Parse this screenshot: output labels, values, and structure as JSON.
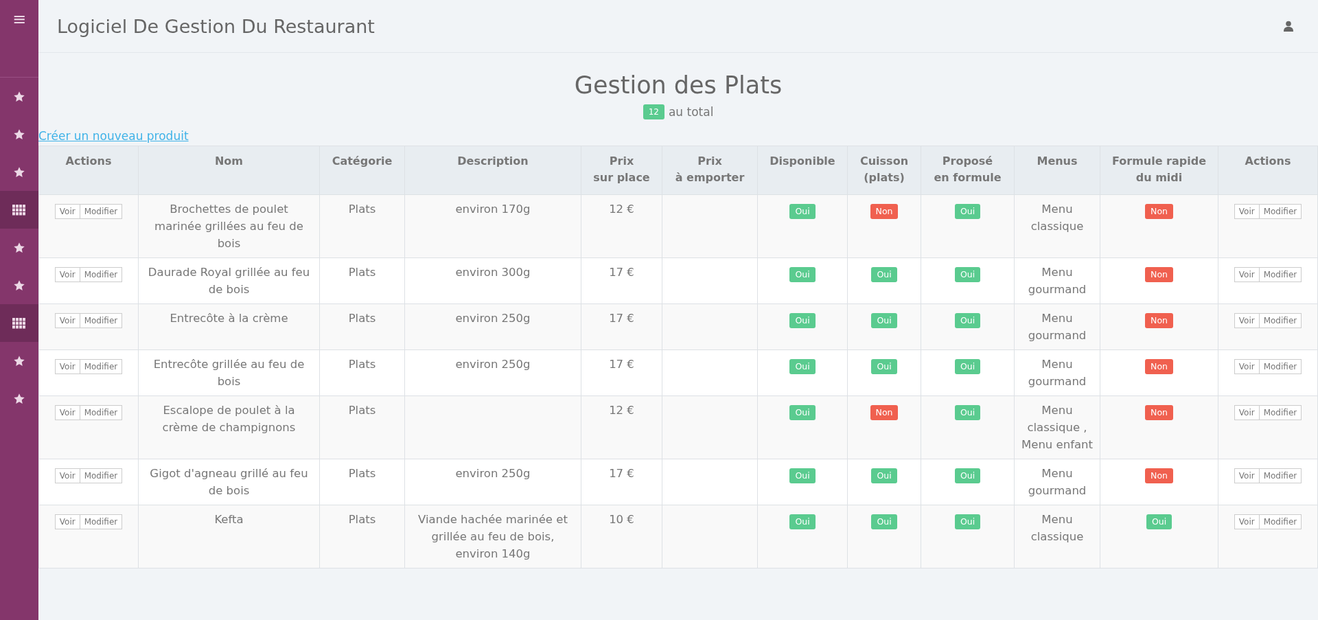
{
  "sidebar": {
    "menu_icon": "≡",
    "items": [
      {
        "kind": "star"
      },
      {
        "kind": "star"
      },
      {
        "kind": "star"
      },
      {
        "kind": "grid"
      },
      {
        "kind": "star"
      },
      {
        "kind": "star"
      },
      {
        "kind": "grid"
      },
      {
        "kind": "star"
      },
      {
        "kind": "star"
      }
    ]
  },
  "header": {
    "title": "Logiciel De Gestion Du Restaurant"
  },
  "page": {
    "title": "Gestion des Plats",
    "count": "12",
    "count_label": "au total",
    "create_link": "Créer un nouveau produit"
  },
  "table": {
    "columns": [
      "Actions",
      "Nom",
      "Catégorie",
      "Description",
      "Prix\nsur place",
      "Prix\nà emporter",
      "Disponible",
      "Cuisson\n(plats)",
      "Proposé\nen formule",
      "Menus",
      "Formule rapide\ndu midi",
      "Actions"
    ],
    "rows": [
      {
        "actions_left": [
          "Voir",
          "Modifier"
        ],
        "name": "Brochettes de poulet marinée grillées au feu de bois",
        "category": "Plats",
        "description": "environ 170g",
        "price_on_site": "12 €",
        "available": {
          "text": "Oui",
          "on": true
        },
        "cooking": {
          "text": "Non",
          "on": false
        },
        "in_formula": {
          "text": "Oui",
          "on": true
        },
        "menus": "Menu classique",
        "lunch_formula": {
          "text": "Non",
          "on": false
        },
        "actions_right": [
          "Voir",
          "Modifier"
        ]
      },
      {
        "actions_left": [
          "Voir",
          "Modifier"
        ],
        "name": "Daurade Royal grillée au feu de bois",
        "category": "Plats",
        "description": "environ 300g",
        "price_on_site": "17 €",
        "available": {
          "text": "Oui",
          "on": true
        },
        "cooking": {
          "text": "Oui",
          "on": true
        },
        "in_formula": {
          "text": "Oui",
          "on": true
        },
        "menus": "Menu gourmand",
        "lunch_formula": {
          "text": "Non",
          "on": false
        },
        "actions_right": [
          "Voir",
          "Modifier"
        ]
      },
      {
        "actions_left": [
          "Voir",
          "Modifier"
        ],
        "name": "Entrecôte à la crème",
        "category": "Plats",
        "description": "environ 250g",
        "price_on_site": "17 €",
        "available": {
          "text": "Oui",
          "on": true
        },
        "cooking": {
          "text": "Oui",
          "on": true
        },
        "in_formula": {
          "text": "Oui",
          "on": true
        },
        "menus": "Menu gourmand",
        "lunch_formula": {
          "text": "Non",
          "on": false
        },
        "actions_right": [
          "Voir",
          "Modifier"
        ]
      },
      {
        "actions_left": [
          "Voir",
          "Modifier"
        ],
        "name": "Entrecôte grillée au feu de bois",
        "category": "Plats",
        "description": "environ 250g",
        "price_on_site": "17 €",
        "available": {
          "text": "Oui",
          "on": true
        },
        "cooking": {
          "text": "Oui",
          "on": true
        },
        "in_formula": {
          "text": "Oui",
          "on": true
        },
        "menus": "Menu gourmand",
        "lunch_formula": {
          "text": "Non",
          "on": false
        },
        "actions_right": [
          "Voir",
          "Modifier"
        ]
      },
      {
        "actions_left": [
          "Voir",
          "Modifier"
        ],
        "name": "Escalope de poulet à la crème de champignons",
        "category": "Plats",
        "price_on_site": "12 €",
        "available": {
          "text": "Oui",
          "on": true
        },
        "cooking": {
          "text": "Non",
          "on": false
        },
        "in_formula": {
          "text": "Oui",
          "on": true
        },
        "menus": "Menu classique , Menu enfant",
        "lunch_formula": {
          "text": "Non",
          "on": false
        },
        "actions_right": [
          "Voir",
          "Modifier"
        ]
      },
      {
        "actions_left": [
          "Voir",
          "Modifier"
        ],
        "name": "Gigot d'agneau grillé au feu de bois",
        "category": "Plats",
        "description": "environ 250g",
        "price_on_site": "17 €",
        "available": {
          "text": "Oui",
          "on": true
        },
        "cooking": {
          "text": "Oui",
          "on": true
        },
        "in_formula": {
          "text": "Oui",
          "on": true
        },
        "menus": "Menu gourmand",
        "lunch_formula": {
          "text": "Non",
          "on": false
        },
        "actions_right": [
          "Voir",
          "Modifier"
        ]
      },
      {
        "actions_left": [
          "Voir",
          "Modifier"
        ],
        "name": "Kefta",
        "category": "Plats",
        "description": "Viande hachée marinée et grillée au feu de bois, environ 140g",
        "price_on_site": "10 €",
        "available": {
          "text": "Oui",
          "on": true
        },
        "cooking": {
          "text": "Oui",
          "on": true
        },
        "in_formula": {
          "text": "Oui",
          "on": true
        },
        "menus": "Menu classique",
        "lunch_formula": {
          "text": "Oui",
          "on": true
        },
        "actions_right": [
          "Voir",
          "Modifier"
        ]
      }
    ]
  }
}
